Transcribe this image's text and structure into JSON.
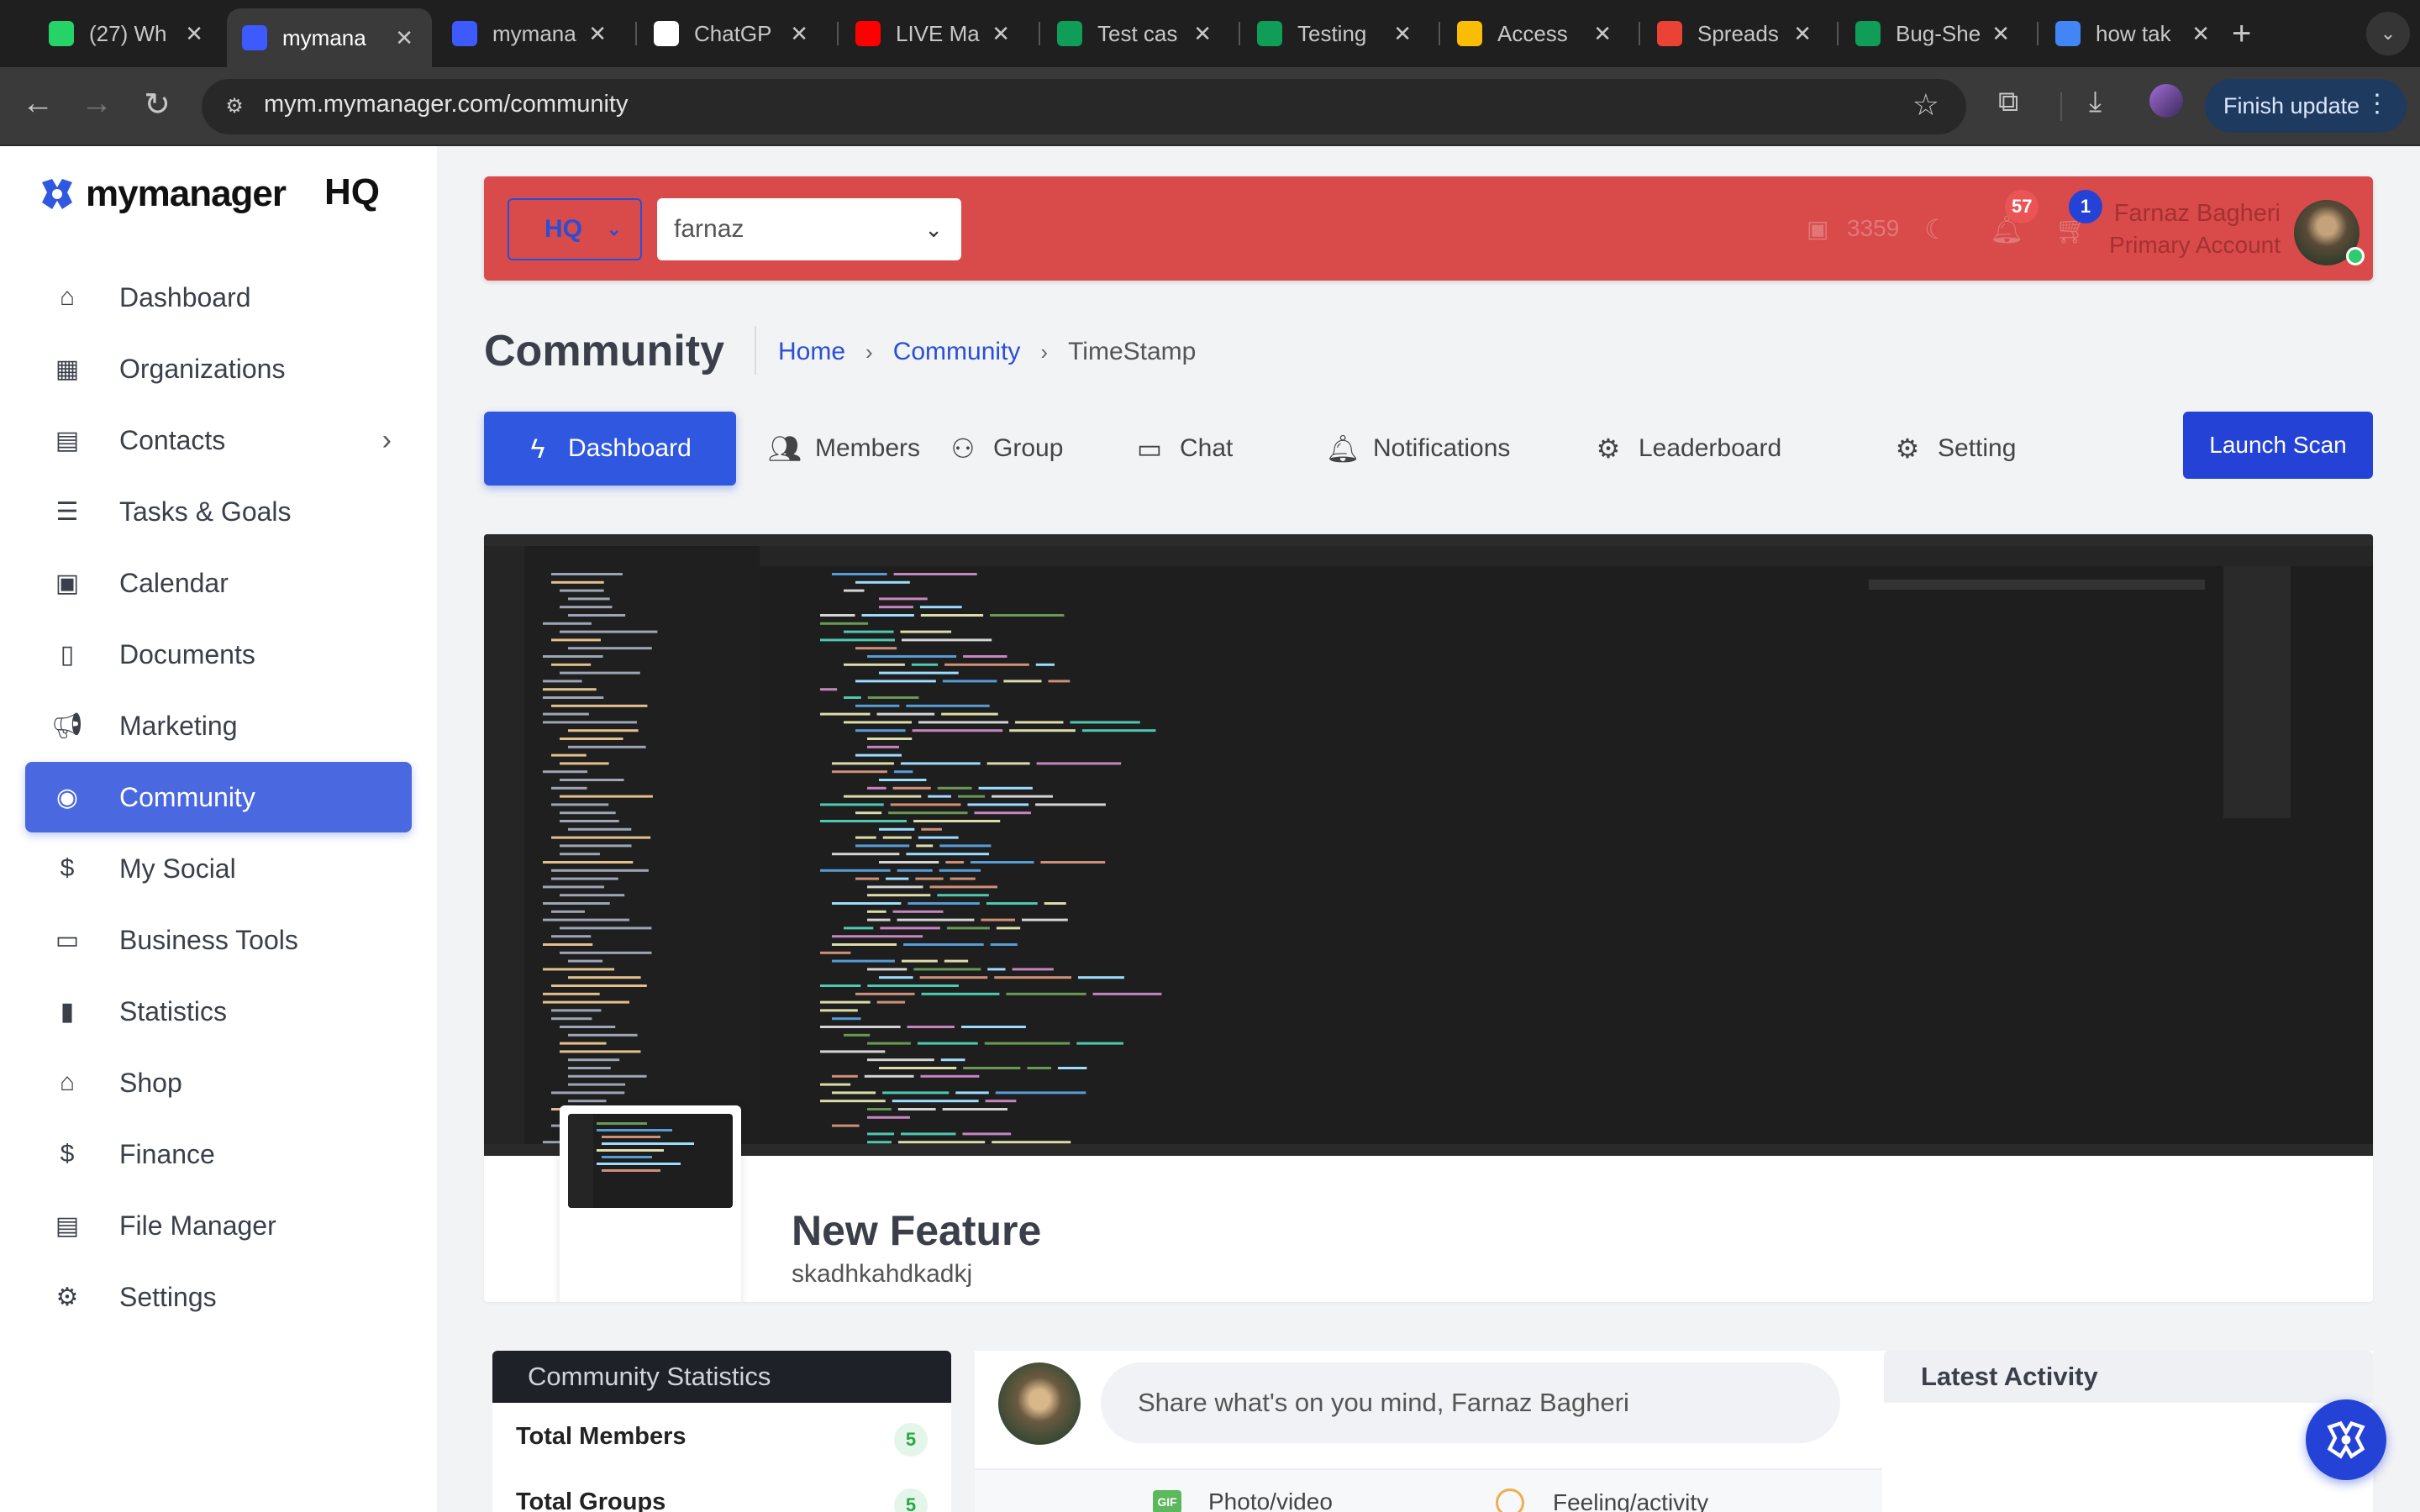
{
  "browser": {
    "tabs": [
      {
        "title": "(27) Wh",
        "favicon_color": "#25D366",
        "icon": "whatsapp-icon",
        "active": false
      },
      {
        "title": "mymana",
        "favicon_color": "#3d5afe",
        "icon": "mymanager-icon",
        "active": true
      },
      {
        "title": "mymana",
        "favicon_color": "#3d5afe",
        "icon": "mymanager-icon",
        "active": false
      },
      {
        "title": "ChatGP",
        "favicon_color": "#ffffff",
        "icon": "chatgpt-icon",
        "active": false
      },
      {
        "title": "LIVE Ma",
        "favicon_color": "#ff0000",
        "icon": "youtube-icon",
        "active": false
      },
      {
        "title": "Test cas",
        "favicon_color": "#0f9d58",
        "icon": "sheets-icon",
        "active": false
      },
      {
        "title": "Testing",
        "favicon_color": "#0f9d58",
        "icon": "sheets-icon",
        "active": false
      },
      {
        "title": "Access",
        "favicon_color": "#fbbc04",
        "icon": "drive-icon",
        "active": false
      },
      {
        "title": "Spreads",
        "favicon_color": "#ea4335",
        "icon": "gmail-icon",
        "active": false
      },
      {
        "title": "Bug-She",
        "favicon_color": "#0f9d58",
        "icon": "sheets-icon",
        "active": false
      },
      {
        "title": "how tak",
        "favicon_color": "#4285f4",
        "icon": "google-icon",
        "active": false
      }
    ],
    "url": "mym.mymanager.com/community",
    "finish_update_label": "Finish update"
  },
  "sidebar": {
    "brand": "mymanager",
    "brand_suffix": "HQ",
    "accent": "#4a68e0",
    "items": [
      {
        "label": "Dashboard",
        "icon": "home-icon"
      },
      {
        "label": "Organizations",
        "icon": "building-icon"
      },
      {
        "label": "Contacts",
        "icon": "contacts-icon",
        "has_submenu": true
      },
      {
        "label": "Tasks & Goals",
        "icon": "tasks-icon"
      },
      {
        "label": "Calendar",
        "icon": "calendar-icon"
      },
      {
        "label": "Documents",
        "icon": "document-icon"
      },
      {
        "label": "Marketing",
        "icon": "megaphone-icon"
      },
      {
        "label": "Community",
        "icon": "community-icon",
        "active": true
      },
      {
        "label": "My Social",
        "icon": "social-icon"
      },
      {
        "label": "Business Tools",
        "icon": "briefcase-icon"
      },
      {
        "label": "Statistics",
        "icon": "bar-chart-icon"
      },
      {
        "label": "Shop",
        "icon": "shop-icon"
      },
      {
        "label": "Finance",
        "icon": "finance-icon"
      },
      {
        "label": "File Manager",
        "icon": "file-manager-icon"
      },
      {
        "label": "Settings",
        "icon": "gear-icon"
      }
    ]
  },
  "topbar": {
    "bg_color": "#d94a4a",
    "org_select": "HQ",
    "user_select": "farnaz",
    "points": "3359",
    "notifications_count": "57",
    "cart_count": "1",
    "user_name": "Farnaz Bagheri",
    "user_role": "Primary Account"
  },
  "page": {
    "title": "Community",
    "breadcrumb": {
      "home": "Home",
      "section": "Community",
      "current": "TimeStamp"
    }
  },
  "community_tabs": [
    {
      "label": "Dashboard",
      "icon": "bolt-icon",
      "active": true
    },
    {
      "label": "Members",
      "icon": "users-icon"
    },
    {
      "label": "Group",
      "icon": "group-icon"
    },
    {
      "label": "Chat",
      "icon": "chat-icon"
    },
    {
      "label": "Notifications",
      "icon": "bell-icon"
    },
    {
      "label": "Leaderboard",
      "icon": "leaderboard-icon"
    },
    {
      "label": "Setting",
      "icon": "gear-icon"
    }
  ],
  "launch_scan_label": "Launch Scan",
  "feature": {
    "title": "New Feature",
    "subtitle": "skadhkahdkadkj"
  },
  "stats": {
    "header": "Community Statistics",
    "rows": [
      {
        "label": "Total Members",
        "value": "5"
      },
      {
        "label": "Total Groups",
        "value": "5"
      }
    ]
  },
  "composer": {
    "placeholder": "Share what's on you mind, Farnaz Bagheri",
    "photo_label": "Photo/video",
    "feeling_label": "Feeling/activity"
  },
  "activity": {
    "header": "Latest Activity"
  }
}
